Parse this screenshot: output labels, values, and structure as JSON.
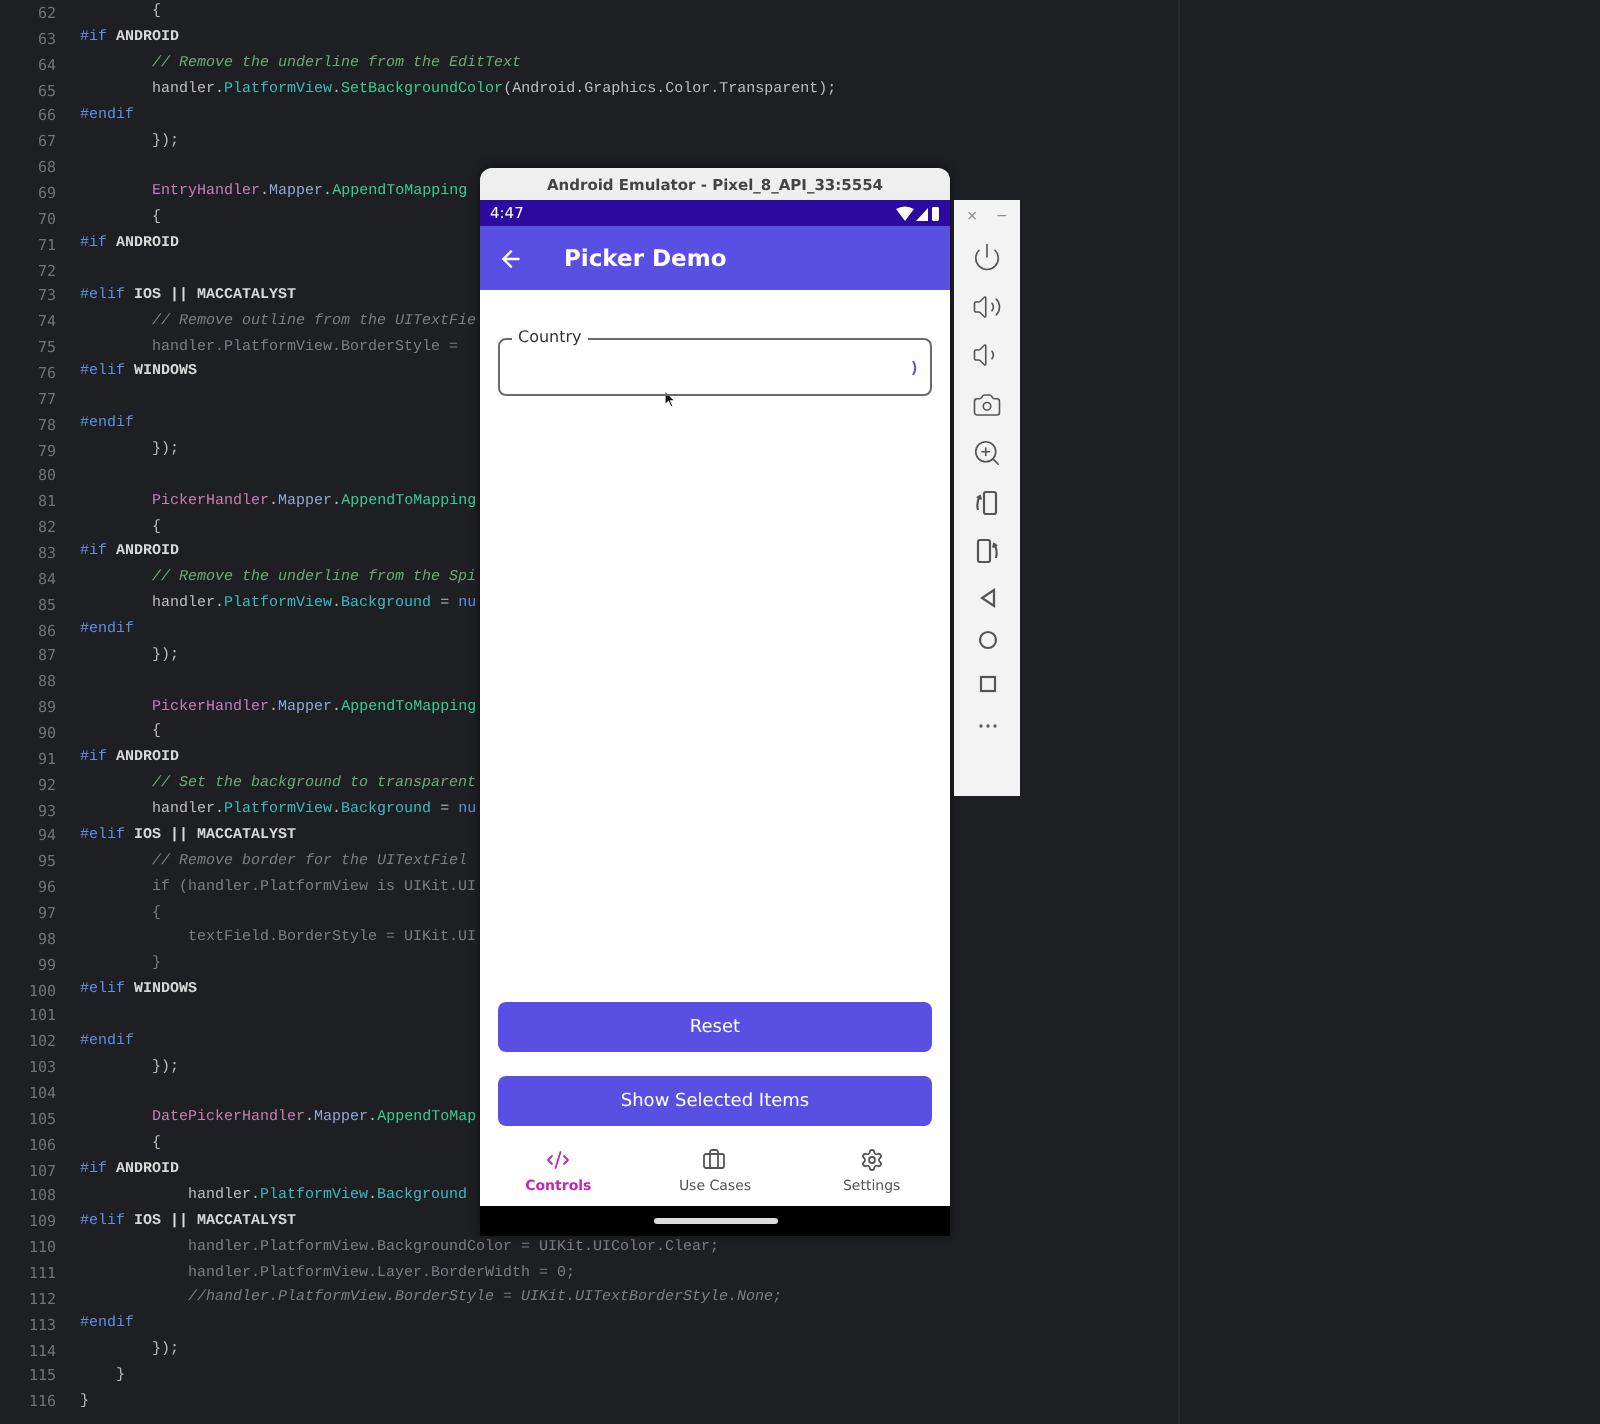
{
  "editor": {
    "lines": [
      {
        "number": "62",
        "kind": "body",
        "inactive": false,
        "segs": [
          {
            "kind": "p",
            "text": "{"
          }
        ]
      },
      {
        "number": "63",
        "kind": "directive",
        "inactive": false,
        "segs": [
          {
            "kind": "d",
            "text": "#if"
          },
          {
            "kind": "s",
            "text": " ANDROID"
          }
        ]
      },
      {
        "number": "64",
        "kind": "body",
        "inactive": false,
        "segs": [
          {
            "kind": "c",
            "text": "// Remove the underline from the EditText"
          }
        ]
      },
      {
        "number": "65",
        "kind": "body",
        "inactive": false,
        "segs": [
          {
            "kind": "p",
            "text": "handler."
          },
          {
            "kind": "m",
            "text": "PlatformView"
          },
          {
            "kind": "p",
            "text": "."
          },
          {
            "kind": "f",
            "text": "SetBackgroundColor"
          },
          {
            "kind": "p",
            "text": "(Android.Graphics.Color.Transparent);"
          }
        ]
      },
      {
        "number": "66",
        "kind": "directive",
        "inactive": false,
        "segs": [
          {
            "kind": "d",
            "text": "#endif"
          }
        ]
      },
      {
        "number": "67",
        "kind": "body",
        "inactive": false,
        "segs": [
          {
            "kind": "p",
            "text": "});"
          }
        ]
      },
      {
        "number": "68"
      },
      {
        "number": "69",
        "kind": "body",
        "inactive": false,
        "segs": [
          {
            "kind": "t",
            "text": "EntryHandler"
          },
          {
            "kind": "p",
            "text": "."
          },
          {
            "kind": "n",
            "text": "Mapper"
          },
          {
            "kind": "p",
            "text": "."
          },
          {
            "kind": "f",
            "text": "AppendToMapping"
          }
        ]
      },
      {
        "number": "70",
        "kind": "body",
        "inactive": false,
        "segs": [
          {
            "kind": "p",
            "text": "{"
          }
        ]
      },
      {
        "number": "71",
        "kind": "directive",
        "inactive": false,
        "segs": [
          {
            "kind": "d",
            "text": "#if"
          },
          {
            "kind": "s",
            "text": " ANDROID"
          }
        ]
      },
      {
        "number": "72"
      },
      {
        "number": "73",
        "kind": "directive",
        "inactive": false,
        "segs": [
          {
            "kind": "d",
            "text": "#elif"
          },
          {
            "kind": "s",
            "text": " IOS || MACCATALYST"
          }
        ]
      },
      {
        "number": "74",
        "kind": "body",
        "inactive": true,
        "segs": [
          {
            "kind": "c",
            "text": "// Remove outline from the UITextFie"
          }
        ]
      },
      {
        "number": "75",
        "kind": "body",
        "inactive": true,
        "segs": [
          {
            "kind": "p",
            "text": "handler.PlatformView.BorderStyle ="
          }
        ]
      },
      {
        "number": "76",
        "kind": "directive",
        "inactive": false,
        "segs": [
          {
            "kind": "d",
            "text": "#elif"
          },
          {
            "kind": "s",
            "text": " WINDOWS"
          }
        ]
      },
      {
        "number": "77"
      },
      {
        "number": "78",
        "kind": "directive",
        "inactive": false,
        "segs": [
          {
            "kind": "d",
            "text": "#endif"
          }
        ]
      },
      {
        "number": "79",
        "kind": "body",
        "inactive": false,
        "segs": [
          {
            "kind": "p",
            "text": "});"
          }
        ]
      },
      {
        "number": "80"
      },
      {
        "number": "81",
        "kind": "body",
        "inactive": false,
        "segs": [
          {
            "kind": "t",
            "text": "PickerHandler"
          },
          {
            "kind": "p",
            "text": "."
          },
          {
            "kind": "n",
            "text": "Mapper"
          },
          {
            "kind": "p",
            "text": "."
          },
          {
            "kind": "f",
            "text": "AppendToMapping"
          }
        ]
      },
      {
        "number": "82",
        "kind": "body",
        "inactive": false,
        "segs": [
          {
            "kind": "p",
            "text": "{"
          }
        ]
      },
      {
        "number": "83",
        "kind": "directive",
        "inactive": false,
        "segs": [
          {
            "kind": "d",
            "text": "#if"
          },
          {
            "kind": "s",
            "text": " ANDROID"
          }
        ]
      },
      {
        "number": "84",
        "kind": "body",
        "inactive": false,
        "segs": [
          {
            "kind": "c",
            "text": "// Remove the underline from the Spi"
          }
        ]
      },
      {
        "number": "85",
        "kind": "body",
        "inactive": false,
        "segs": [
          {
            "kind": "p",
            "text": "handler."
          },
          {
            "kind": "m",
            "text": "PlatformView"
          },
          {
            "kind": "p",
            "text": "."
          },
          {
            "kind": "m",
            "text": "Background"
          },
          {
            "kind": "p",
            "text": " = "
          },
          {
            "kind": "k",
            "text": "nu"
          }
        ]
      },
      {
        "number": "86",
        "kind": "directive",
        "inactive": false,
        "segs": [
          {
            "kind": "d",
            "text": "#endif"
          }
        ]
      },
      {
        "number": "87",
        "kind": "body",
        "inactive": false,
        "segs": [
          {
            "kind": "p",
            "text": "});"
          }
        ]
      },
      {
        "number": "88"
      },
      {
        "number": "89",
        "kind": "body",
        "inactive": false,
        "segs": [
          {
            "kind": "t",
            "text": "PickerHandler"
          },
          {
            "kind": "p",
            "text": "."
          },
          {
            "kind": "n",
            "text": "Mapper"
          },
          {
            "kind": "p",
            "text": "."
          },
          {
            "kind": "f",
            "text": "AppendToMapping"
          }
        ]
      },
      {
        "number": "90",
        "kind": "body",
        "inactive": false,
        "segs": [
          {
            "kind": "p",
            "text": "{"
          }
        ]
      },
      {
        "number": "91",
        "kind": "directive",
        "inactive": false,
        "segs": [
          {
            "kind": "d",
            "text": "#if"
          },
          {
            "kind": "s",
            "text": " ANDROID"
          }
        ]
      },
      {
        "number": "92",
        "kind": "body",
        "inactive": false,
        "segs": [
          {
            "kind": "c",
            "text": "// Set the background to transparent"
          }
        ]
      },
      {
        "number": "93",
        "kind": "body",
        "inactive": false,
        "segs": [
          {
            "kind": "p",
            "text": "handler."
          },
          {
            "kind": "m",
            "text": "PlatformView"
          },
          {
            "kind": "p",
            "text": "."
          },
          {
            "kind": "m",
            "text": "Background"
          },
          {
            "kind": "p",
            "text": " = "
          },
          {
            "kind": "k",
            "text": "nu"
          }
        ]
      },
      {
        "number": "94",
        "kind": "directive",
        "inactive": false,
        "segs": [
          {
            "kind": "d",
            "text": "#elif"
          },
          {
            "kind": "s",
            "text": " IOS || MACCATALYST"
          }
        ]
      },
      {
        "number": "95",
        "kind": "body",
        "inactive": true,
        "segs": [
          {
            "kind": "c",
            "text": "// Remove border for the UITextFiel"
          }
        ]
      },
      {
        "number": "96",
        "kind": "body",
        "inactive": true,
        "segs": [
          {
            "kind": "p",
            "text": "if (handler.PlatformView is UIKit.UI"
          }
        ]
      },
      {
        "number": "97",
        "kind": "body",
        "inactive": true,
        "segs": [
          {
            "kind": "p",
            "text": "{"
          }
        ]
      },
      {
        "number": "98",
        "kind": "inner",
        "inactive": true,
        "segs": [
          {
            "kind": "p",
            "text": "textField.BorderStyle = UIKit.UI"
          }
        ]
      },
      {
        "number": "99",
        "kind": "body",
        "inactive": true,
        "segs": [
          {
            "kind": "p",
            "text": "}"
          }
        ]
      },
      {
        "number": "100",
        "kind": "directive",
        "inactive": false,
        "segs": [
          {
            "kind": "d",
            "text": "#elif"
          },
          {
            "kind": "s",
            "text": " WINDOWS"
          }
        ]
      },
      {
        "number": "101"
      },
      {
        "number": "102",
        "kind": "directive",
        "inactive": false,
        "segs": [
          {
            "kind": "d",
            "text": "#endif"
          }
        ]
      },
      {
        "number": "103",
        "kind": "body",
        "inactive": false,
        "segs": [
          {
            "kind": "p",
            "text": "});"
          }
        ]
      },
      {
        "number": "104"
      },
      {
        "number": "105",
        "kind": "body",
        "inactive": false,
        "segs": [
          {
            "kind": "t",
            "text": "DatePickerHandler"
          },
          {
            "kind": "p",
            "text": "."
          },
          {
            "kind": "n",
            "text": "Mapper"
          },
          {
            "kind": "p",
            "text": "."
          },
          {
            "kind": "f",
            "text": "AppendToMap"
          }
        ]
      },
      {
        "number": "106",
        "kind": "body",
        "inactive": false,
        "segs": [
          {
            "kind": "p",
            "text": "{"
          }
        ]
      },
      {
        "number": "107",
        "kind": "directive",
        "inactive": false,
        "segs": [
          {
            "kind": "d",
            "text": "#if"
          },
          {
            "kind": "s",
            "text": " ANDROID"
          }
        ]
      },
      {
        "number": "108",
        "kind": "inner",
        "inactive": false,
        "segs": [
          {
            "kind": "p",
            "text": "handler."
          },
          {
            "kind": "m",
            "text": "PlatformView"
          },
          {
            "kind": "p",
            "text": "."
          },
          {
            "kind": "m",
            "text": "Background"
          }
        ]
      },
      {
        "number": "109",
        "kind": "directive",
        "inactive": false,
        "segs": [
          {
            "kind": "d",
            "text": "#elif"
          },
          {
            "kind": "s",
            "text": " IOS || MACCATALYST"
          }
        ]
      },
      {
        "number": "110",
        "kind": "inner",
        "inactive": true,
        "segs": [
          {
            "kind": "p",
            "text": "handler.PlatformView.BackgroundColor = UIKit.UIColor.Clear;"
          }
        ]
      },
      {
        "number": "111",
        "kind": "inner",
        "inactive": true,
        "segs": [
          {
            "kind": "p",
            "text": "handler.PlatformView.Layer.BorderWidth = 0;"
          }
        ]
      },
      {
        "number": "112",
        "kind": "inner",
        "inactive": true,
        "segs": [
          {
            "kind": "c",
            "text": "//handler.PlatformView.BorderStyle = UIKit.UITextBorderStyle.None;"
          }
        ]
      },
      {
        "number": "113",
        "kind": "directive",
        "inactive": false,
        "segs": [
          {
            "kind": "d",
            "text": "#endif"
          }
        ]
      },
      {
        "number": "114",
        "kind": "body",
        "inactive": false,
        "segs": [
          {
            "kind": "p",
            "text": "});"
          }
        ]
      },
      {
        "number": "115",
        "kind": "block",
        "inactive": false,
        "segs": [
          {
            "kind": "p",
            "text": "}"
          }
        ]
      },
      {
        "number": "116",
        "kind": "directive",
        "inactive": false,
        "segs": [
          {
            "kind": "p",
            "text": "}"
          }
        ]
      }
    ]
  },
  "emulator": {
    "title": "Android Emulator - Pixel_8_API_33:5554",
    "window_controls": [
      "×",
      "−"
    ],
    "status_bar": {
      "time": "4:47"
    },
    "app_bar": {
      "title": "Picker Demo"
    },
    "country_field": {
      "label": "Country"
    },
    "buttons": [
      "Reset",
      "Show Selected Items"
    ],
    "tab_bar": [
      {
        "label": "Controls",
        "selected": true
      },
      {
        "label": "Use Cases",
        "selected": false
      },
      {
        "label": "Settings",
        "selected": false
      }
    ]
  }
}
